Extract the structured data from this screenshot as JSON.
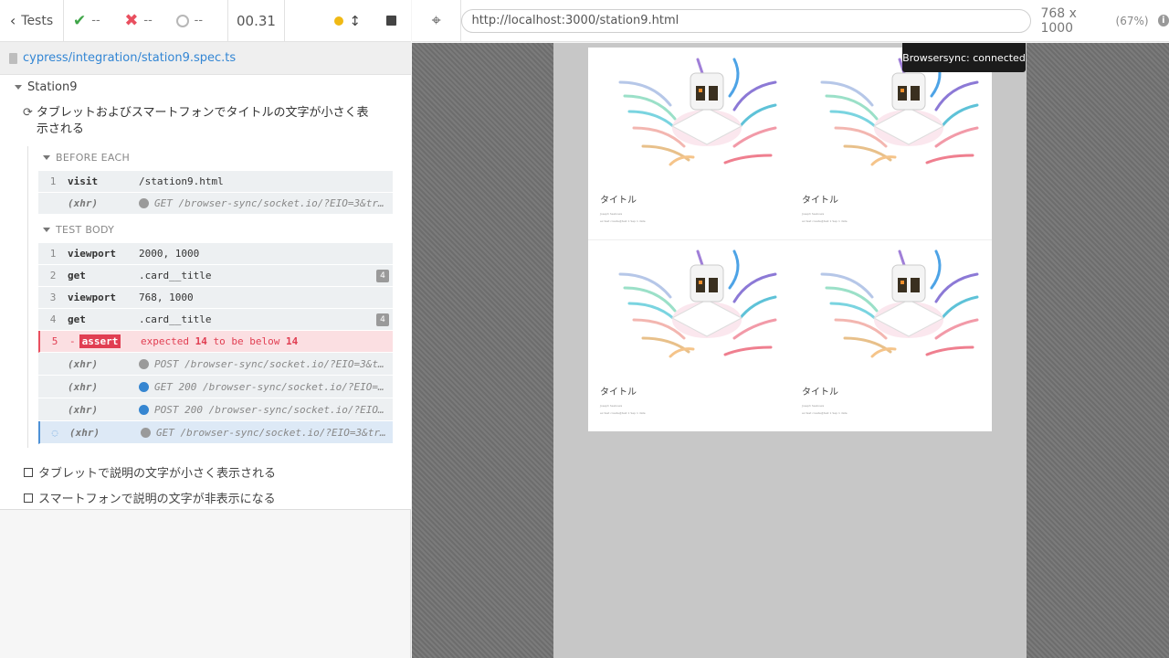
{
  "header": {
    "tests_label": "Tests",
    "passed": "--",
    "failed": "--",
    "pending": "--",
    "duration": "00.31"
  },
  "spec": {
    "path": "cypress/integration/station9.spec.ts"
  },
  "suite": {
    "title": "Station9",
    "test_title": "タブレットおよびスマートフォンでタイトルの文字が小さく表示される",
    "before_each_label": "BEFORE EACH",
    "test_body_label": "TEST BODY",
    "before_each": [
      {
        "num": "1",
        "name": "visit",
        "msg": "/station9.html"
      },
      {
        "num": "",
        "name": "(xhr)",
        "msg": "GET /browser-sync/socket.io/?EIO=3&transport=polling"
      }
    ],
    "body": [
      {
        "num": "1",
        "name": "viewport",
        "msg": "2000, 1000"
      },
      {
        "num": "2",
        "name": "get",
        "msg": ".card__title",
        "count": "4"
      },
      {
        "num": "3",
        "name": "viewport",
        "msg": "768, 1000"
      },
      {
        "num": "4",
        "name": "get",
        "msg": ".card__title",
        "count": "4"
      }
    ],
    "assert": {
      "num": "5",
      "dash": "-",
      "label": "assert",
      "pre": "expected ",
      "a": "14",
      "mid": " to be below ",
      "b": "14"
    },
    "xhrs": [
      {
        "name": "(xhr)",
        "msg": "POST /browser-sync/socket.io/?EIO=3&transport=polling",
        "dot": "gray"
      },
      {
        "name": "(xhr)",
        "msg": "GET 200 /browser-sync/socket.io/?EIO=3&transport=polling",
        "dot": "blue"
      },
      {
        "name": "(xhr)",
        "msg": "POST 200 /browser-sync/socket.io/?EIO=3&transport=polling",
        "dot": "blue"
      },
      {
        "name": "(xhr)",
        "msg": "GET /browser-sync/socket.io/?EIO=3&transport=polling",
        "dot": "gray"
      }
    ],
    "other_tests": [
      "タブレットで説明の文字が小さく表示される",
      "スマートフォンで説明の文字が非表示になる"
    ]
  },
  "aut": {
    "url": "http://localhost:3000/station9.html",
    "viewport": "768 x 1000",
    "scale": "(67%)",
    "toast": "Browsersync: connected"
  },
  "cards": [
    {
      "title": "タイトル",
      "meta1": "Joseph Ssebowa",
      "meta2": "ex:test create@test 1 Sep 1 date"
    },
    {
      "title": "タイトル",
      "meta1": "Joseph Ssebowa",
      "meta2": "ex:test create@test 1 Sep 1 date"
    },
    {
      "title": "タイトル",
      "meta1": "Joseph Ssebowa",
      "meta2": "ex:test create@test 1 Sep 1 date"
    },
    {
      "title": "タイトル",
      "meta1": "Joseph Ssebowa",
      "meta2": "ex:test create@test 1 Sep 1 date"
    }
  ],
  "colors": {
    "pass": "#3fa548",
    "fail": "#e94f5f",
    "accent": "#3386d4",
    "running": "#f0b914"
  },
  "icons": [
    "chevron-left-icon",
    "check-icon",
    "x-icon",
    "circle-icon",
    "status-dot-icon",
    "scroll-icon",
    "stop-icon",
    "file-icon",
    "refresh-icon",
    "crosshair-icon",
    "info-icon"
  ]
}
